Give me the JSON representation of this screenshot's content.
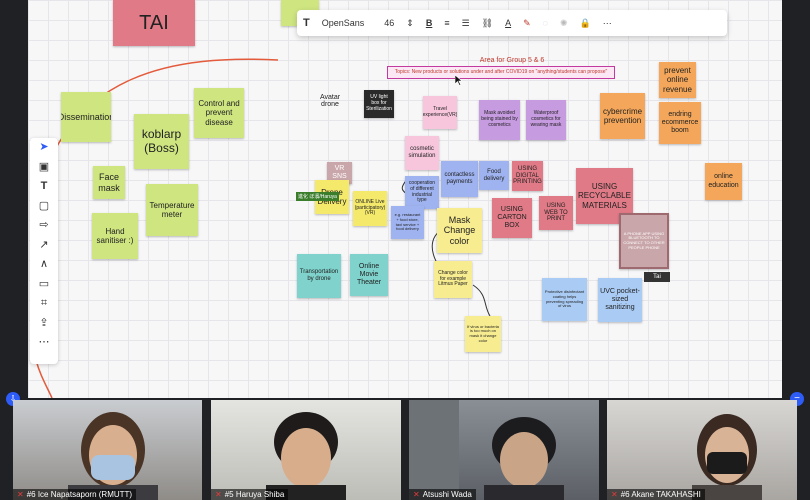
{
  "formatting_toolbar": {
    "text_icon": "T",
    "font_name": "OpenSans",
    "font_size": "46",
    "bold_icon": "B"
  },
  "left_toolbar": {
    "tools": [
      "select",
      "frame",
      "text",
      "sticky-note",
      "shape",
      "line",
      "pen",
      "comment",
      "crop",
      "upload",
      "more"
    ]
  },
  "board_heading": "Area for Group 5 & 6",
  "topic_text": "Topics: New products or solutions under and after COVID19 on \"anything/students can propose\"",
  "notes": {
    "tai": "TAI",
    "dissemination": "Dissemination",
    "koblarp": "koblarp (Boss)",
    "control": "Control and prevent disease",
    "face_mask": "Face mask",
    "temperature": "Temperature meter",
    "hand_sanitiser": "Hand sanitiser :)",
    "avatar_drone": "Avatar drone",
    "uv_light_box": "UV light box for Sterilization",
    "travel_vr": "Travel experience(VR)",
    "mask_stained": "Mask avoided being stained by cosmetics",
    "waterproof": "Waterproof cosmetics for wearing mask",
    "cybercrime": "cybercrime prevention",
    "prevent_online": "prevent online revenue",
    "ending_ecommerce": "endring ecommerce boom",
    "cosmetic_sim": "cosmetic simulation",
    "vr_sns": "VR SNS",
    "drone_delivery": "Drone Delivery",
    "online_live": "ONLINE Live (participatory) (VR)",
    "cooperation": "cooperation of different industrial type",
    "contactless": "contactless payments",
    "food_delivery": "Food delivery",
    "digital_printing": "USING DIGITAL PRINTING",
    "recyclable": "USING RECYCLABLE MATERIALS",
    "online_education": "online education",
    "restaurant": "e.g. restaurant + food store, taxi service + food delivery",
    "mask_change": "Mask Change color",
    "carton_box": "USING CARTON BOX",
    "web_to_print": "USING WEB TO PRINT",
    "phone_app": "A PHONE APP USING BLUETOOTH TO CONNECT TO OTHER PEOPLE PHONE",
    "transportation": "Transportation by drone",
    "online_movie": "Online Movie Theater",
    "change_color_example": "Change color for example Litmus Paper",
    "protective": "Protective disinfectant coating helps preventing spreading of virus",
    "uvc": "UVC pocket-sized sanitizing",
    "virus_bacteria": "If virus or bacteria is too much on mask it change color"
  },
  "cursor_label": "進化 ぼ濱/Haruya",
  "user_badge": "Tai",
  "participants": [
    {
      "label": "#6 Ice Napatsaporn (RMUTT)"
    },
    {
      "label": "#5 Haruya Shiba"
    },
    {
      "label": "Atsushi Wada"
    },
    {
      "label": "#6 Akane TAKAHASHI"
    }
  ],
  "colors": {
    "accent": "#2d5cf6",
    "muted_mic": "#e23b3b",
    "board_bg": "#f7f7f8"
  }
}
